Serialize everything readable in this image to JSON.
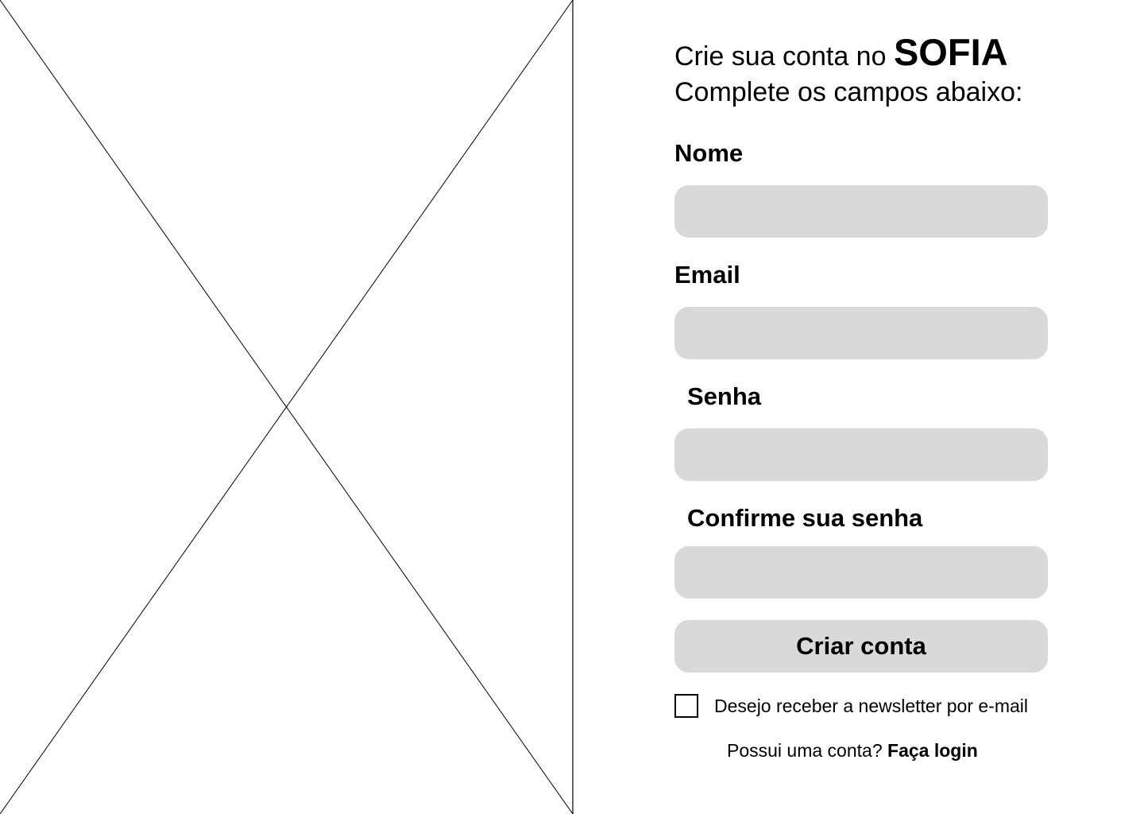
{
  "header": {
    "title_prefix": "Crie sua conta no",
    "brand": "SOFIA",
    "subtitle": "Complete os campos abaixo:"
  },
  "fields": {
    "name": {
      "label": "Nome",
      "value": "",
      "placeholder": ""
    },
    "email": {
      "label": "Email",
      "value": "",
      "placeholder": ""
    },
    "password": {
      "label": "Senha",
      "value": "",
      "placeholder": ""
    },
    "confirm_password": {
      "label": "Confirme sua senha",
      "value": "",
      "placeholder": ""
    }
  },
  "submit": {
    "label": "Criar conta"
  },
  "newsletter": {
    "label": "Desejo receber a newsletter por e-mail",
    "checked": false
  },
  "login": {
    "prompt": "Possui uma conta?",
    "link": "Faça login"
  },
  "colors": {
    "background": "#ffffff",
    "input_fill": "#d9d9d9",
    "text": "#000000"
  }
}
